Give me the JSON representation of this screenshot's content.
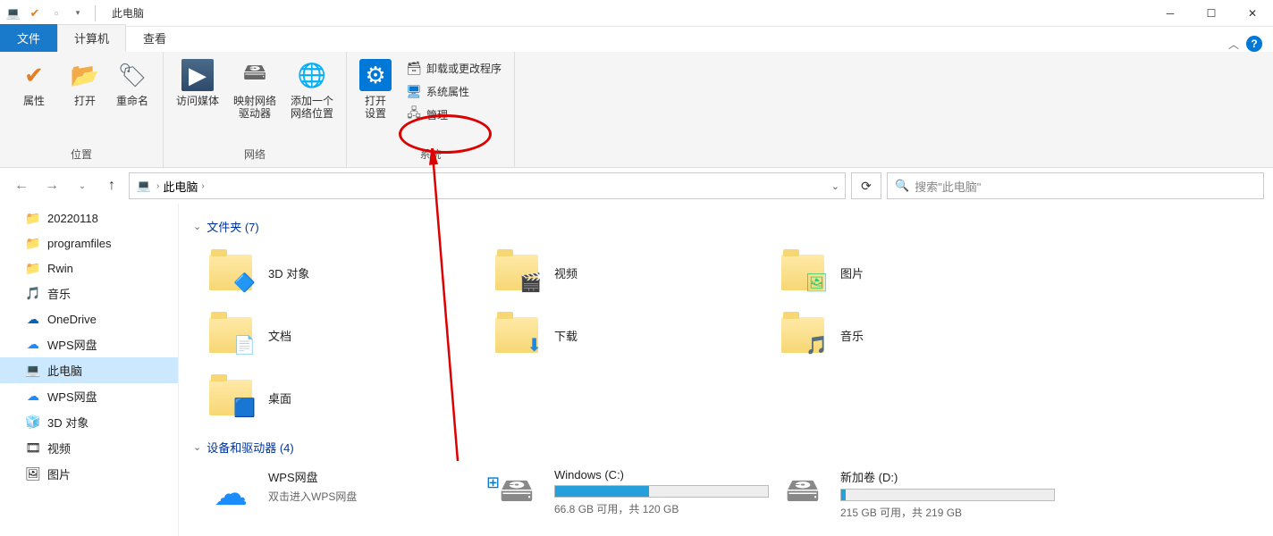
{
  "window": {
    "title": "此电脑"
  },
  "tabs": {
    "file": "文件",
    "computer": "计算机",
    "view": "查看"
  },
  "ribbon": {
    "group_location": "位置",
    "group_network": "网络",
    "group_system": "系统",
    "properties": "属性",
    "open": "打开",
    "rename": "重命名",
    "access_media": "访问媒体",
    "map_drive": "映射网络\n驱动器",
    "add_location": "添加一个\n网络位置",
    "open_settings": "打开\n设置",
    "uninstall": "卸载或更改程序",
    "sysprop": "系统属性",
    "manage": "管理"
  },
  "nav": {
    "this_pc": "此电脑",
    "search_placeholder": "搜索\"此电脑\""
  },
  "tree": [
    {
      "icon": "folder",
      "label": "20220118"
    },
    {
      "icon": "folder",
      "label": "programfiles"
    },
    {
      "icon": "folder",
      "label": "Rwin"
    },
    {
      "icon": "music",
      "label": "音乐"
    },
    {
      "icon": "onedrive",
      "label": "OneDrive"
    },
    {
      "icon": "wps",
      "label": "WPS网盘"
    },
    {
      "icon": "pc",
      "label": "此电脑",
      "selected": true
    },
    {
      "icon": "wps",
      "label": "WPS网盘"
    },
    {
      "icon": "3d",
      "label": "3D 对象"
    },
    {
      "icon": "video",
      "label": "视频"
    },
    {
      "icon": "pic",
      "label": "图片"
    }
  ],
  "content": {
    "folders_header": "文件夹 (7)",
    "drives_header": "设备和驱动器 (4)",
    "folders": [
      {
        "name": "3D 对象",
        "overlay": "cube"
      },
      {
        "name": "视频",
        "overlay": "film"
      },
      {
        "name": "图片",
        "overlay": "pic"
      },
      {
        "name": "文档",
        "overlay": "doc"
      },
      {
        "name": "下载",
        "overlay": "down"
      },
      {
        "name": "音乐",
        "overlay": "note"
      },
      {
        "name": "桌面",
        "overlay": "desk"
      }
    ],
    "drives": [
      {
        "name": "WPS网盘",
        "sub": "双击进入WPS网盘",
        "type": "cloud"
      },
      {
        "name": "Windows (C:)",
        "bar": 44,
        "free": "66.8 GB 可用，共 120 GB",
        "type": "disk",
        "os": true
      },
      {
        "name": "新加卷 (D:)",
        "bar": 2,
        "free": "215 GB 可用，共 219 GB",
        "type": "disk"
      }
    ]
  }
}
